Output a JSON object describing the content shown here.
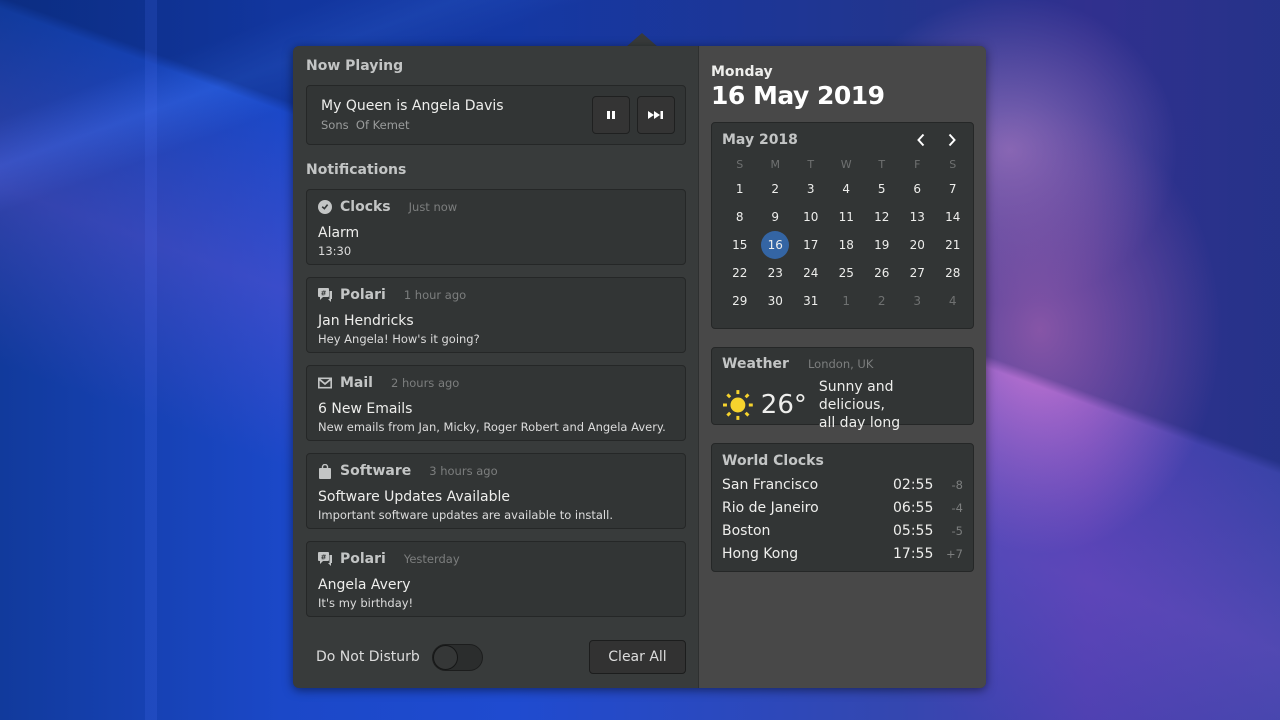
{
  "now_playing": {
    "section_title": "Now Playing",
    "track_title": "My Queen is Angela Davis",
    "artist": "Sons  Of Kemet",
    "pause_icon": "pause-icon",
    "next_icon": "skip-forward-icon"
  },
  "notifications": {
    "section_title": "Notifications",
    "items": [
      {
        "app": "Clocks",
        "icon": "clock-icon",
        "time": "Just now",
        "summary": "Alarm",
        "body": "13:30"
      },
      {
        "app": "Polari",
        "icon": "chat-icon",
        "time": "1 hour ago",
        "summary": "Jan Hendricks",
        "body": "Hey Angela! How's it going?"
      },
      {
        "app": "Mail",
        "icon": "mail-icon",
        "time": "2 hours ago",
        "summary": "6 New Emails",
        "body": "New emails from Jan, Micky, Roger Robert and Angela Avery."
      },
      {
        "app": "Software",
        "icon": "shopping-bag-icon",
        "time": "3 hours ago",
        "summary": "Software Updates Available",
        "body": "Important software updates are available to install."
      },
      {
        "app": "Polari",
        "icon": "chat-icon",
        "time": "Yesterday",
        "summary": "Angela Avery",
        "body": "It's my birthday!"
      }
    ]
  },
  "footer": {
    "dnd_label": "Do Not Disturb",
    "dnd_enabled": false,
    "clear_all_label": "Clear All"
  },
  "date_header": {
    "day_name": "Monday",
    "full_date": "16 May 2019"
  },
  "calendar": {
    "month_label": "May 2018",
    "weekdays": [
      "S",
      "M",
      "T",
      "W",
      "T",
      "F",
      "S"
    ],
    "weeks": [
      [
        "1",
        "2",
        "3",
        "4",
        "5",
        "6",
        "7"
      ],
      [
        "8",
        "9",
        "10",
        "11",
        "12",
        "13",
        "14"
      ],
      [
        "15",
        "16",
        "17",
        "18",
        "19",
        "20",
        "21"
      ],
      [
        "22",
        "23",
        "24",
        "25",
        "26",
        "27",
        "28"
      ],
      [
        "29",
        "30",
        "31",
        "1",
        "2",
        "3",
        "4"
      ]
    ],
    "selected_day": "16",
    "trailing_other_month_count": 4
  },
  "weather": {
    "title": "Weather",
    "location": "London, UK",
    "icon": "sun-icon",
    "temperature": "26°",
    "description_line1": "Sunny and delicious,",
    "description_line2": "all day long",
    "icon_color": "#f6d32d"
  },
  "world_clocks": {
    "title": "World Clocks",
    "items": [
      {
        "city": "San Francisco",
        "time": "02:55",
        "offset": "-8"
      },
      {
        "city": "Rio de Janeiro",
        "time": "06:55",
        "offset": "-4"
      },
      {
        "city": "Boston",
        "time": "05:55",
        "offset": "-5"
      },
      {
        "city": "Hong Kong",
        "time": "17:55",
        "offset": "+7"
      }
    ]
  },
  "colors": {
    "accent": "#3465a4",
    "popover_bg": "#383b3b",
    "sidebar_bg": "#484848"
  }
}
